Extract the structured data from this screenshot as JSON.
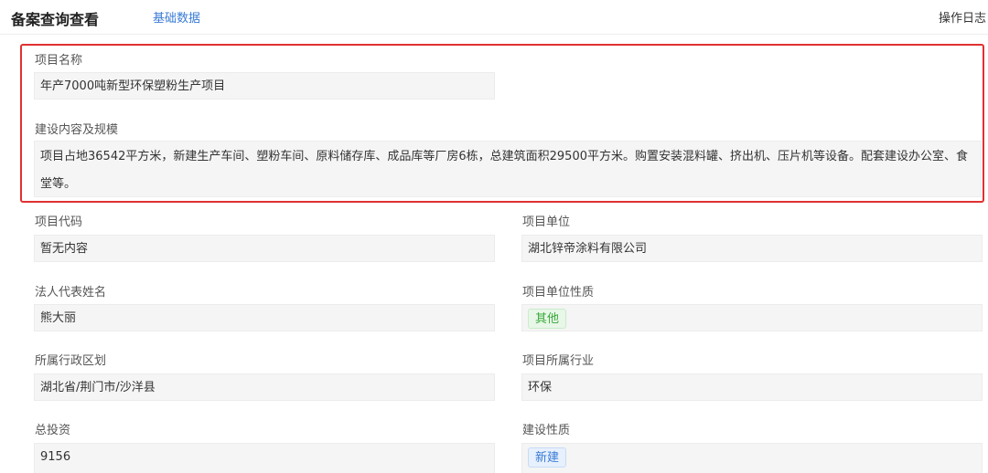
{
  "header": {
    "title": "备案查询查看",
    "tab_basic": "基础数据",
    "oplog": "操作日志"
  },
  "fields": {
    "project_name": {
      "label": "项目名称",
      "value": "年产7000吨新型环保塑粉生产项目"
    },
    "construction": {
      "label": "建设内容及规模",
      "value": "项目占地36542平方米，新建生产车间、塑粉车间、原料储存库、成品库等厂房6栋，总建筑面积29500平方米。购置安装混料罐、挤出机、压片机等设备。配套建设办公室、食堂等。"
    },
    "project_code": {
      "label": "项目代码",
      "value": "暂无内容"
    },
    "project_unit": {
      "label": "项目单位",
      "value": "湖北锌帝涂料有限公司"
    },
    "legal_rep": {
      "label": "法人代表姓名",
      "value": "熊大丽"
    },
    "unit_nature": {
      "label": "项目单位性质",
      "value": "其他"
    },
    "region": {
      "label": "所属行政区划",
      "value": "湖北省/荆门市/沙洋县"
    },
    "industry": {
      "label": "项目所属行业",
      "value": "环保"
    },
    "total_investment": {
      "label": "总投资",
      "value": "9156"
    },
    "build_nature": {
      "label": "建设性质",
      "value": "新建"
    }
  },
  "colors": {
    "accent": "#3a7bd5",
    "highlight_border": "#e03131",
    "tag_green": "#3aa83a"
  }
}
